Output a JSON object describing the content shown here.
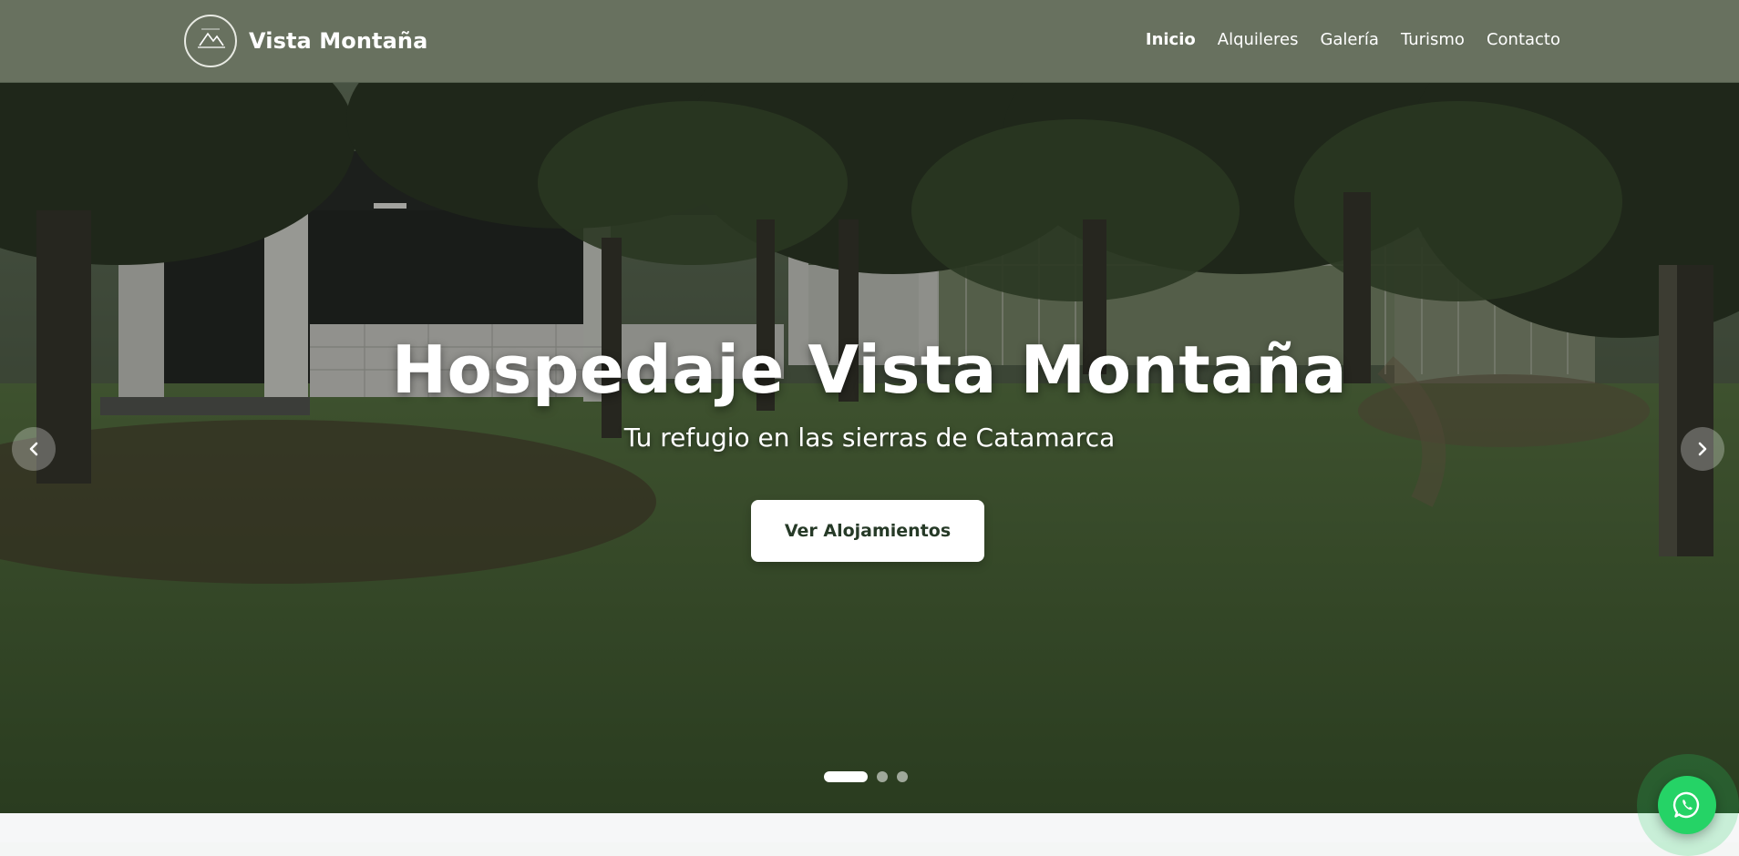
{
  "brand": {
    "name": "Vista Montaña",
    "logo_text": "Vista Montaña",
    "logo_icon": "mountain-logo"
  },
  "nav": {
    "items": [
      {
        "label": "Inicio",
        "active": true
      },
      {
        "label": "Alquileres",
        "active": false
      },
      {
        "label": "Galería",
        "active": false
      },
      {
        "label": "Turismo",
        "active": false
      },
      {
        "label": "Contacto",
        "active": false
      }
    ]
  },
  "hero": {
    "title": "Hospedaje Vista Montaña",
    "subtitle": "Tu refugio en las sierras de Catamarca",
    "cta_label": "Ver Alojamientos",
    "prev_icon": "chevron-left-icon",
    "next_icon": "chevron-right-icon",
    "slide_count": 3,
    "active_slide": 1
  },
  "floating": {
    "whatsapp_icon": "whatsapp-icon"
  },
  "colors": {
    "header_bg": "#68715f",
    "button_text": "#263a27",
    "whatsapp": "#25d366"
  }
}
